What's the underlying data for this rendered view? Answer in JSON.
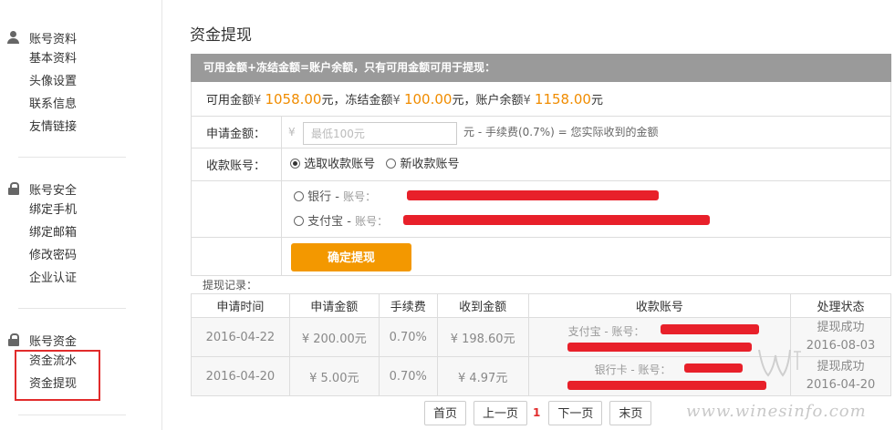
{
  "sidebar": {
    "groups": [
      {
        "title": "账号资料",
        "icon": "user-icon",
        "items": [
          "基本资料",
          "头像设置",
          "联系信息",
          "友情链接"
        ]
      },
      {
        "title": "账号安全",
        "icon": "lock-icon",
        "items": [
          "绑定手机",
          "绑定邮箱",
          "修改密码",
          "企业认证"
        ]
      },
      {
        "title": "账号资金",
        "icon": "lock-icon",
        "items": [
          "资金流水",
          "资金提现"
        ]
      }
    ]
  },
  "page": {
    "title": "资金提现",
    "info_bar": "可用金额+冻结金额=账户余额，只有可用金额可用于提现："
  },
  "balances": {
    "available_label": "可用金额",
    "available_amount": "1058.00",
    "frozen_label": "冻结金额",
    "frozen_amount": "100.00",
    "total_label": "账户余额",
    "total_amount": "1158.00",
    "currency": "¥",
    "unit": "元"
  },
  "form": {
    "amount_label": "申请金额：",
    "amount_prefix": "¥",
    "amount_placeholder": "最低100元",
    "fee_text": "元 - 手续费(0.7%) = 您实际收到的金额",
    "account_label": "收款账号：",
    "option_select": "选取收款账号",
    "option_new": "新收款账号",
    "bank_label": "银行 -",
    "bank_sub": "账号：",
    "alipay_label": "支付宝 -",
    "alipay_sub": "账号：",
    "confirm_label": "确定提现"
  },
  "records": {
    "label": "提现记录：",
    "headers": [
      "申请时间",
      "申请金额",
      "手续费",
      "收到金额",
      "收款账号",
      "处理状态"
    ],
    "rows": [
      {
        "date": "2016-04-22",
        "amount": "¥ 200.00元",
        "fee": "0.70%",
        "received": "¥ 198.60元",
        "account": "支付宝 - 账号：",
        "status": "提现成功",
        "status_date": "2016-08-03"
      },
      {
        "date": "2016-04-20",
        "amount": "¥ 5.00元",
        "fee": "0.70%",
        "received": "¥ 4.97元",
        "account": "银行卡 - 账号：",
        "status": "提现成功",
        "status_date": "2016-04-20"
      }
    ]
  },
  "pager": {
    "first": "首页",
    "prev": "上一页",
    "current": "1",
    "next": "下一页",
    "last": "末页"
  },
  "watermark": "www.winesinfo.com",
  "colors": {
    "accent": "#f39800",
    "amount": "#f08c00",
    "info_bar": "#9a9a9a",
    "redaction": "#e8202a",
    "highlight": "#e12b2b"
  }
}
